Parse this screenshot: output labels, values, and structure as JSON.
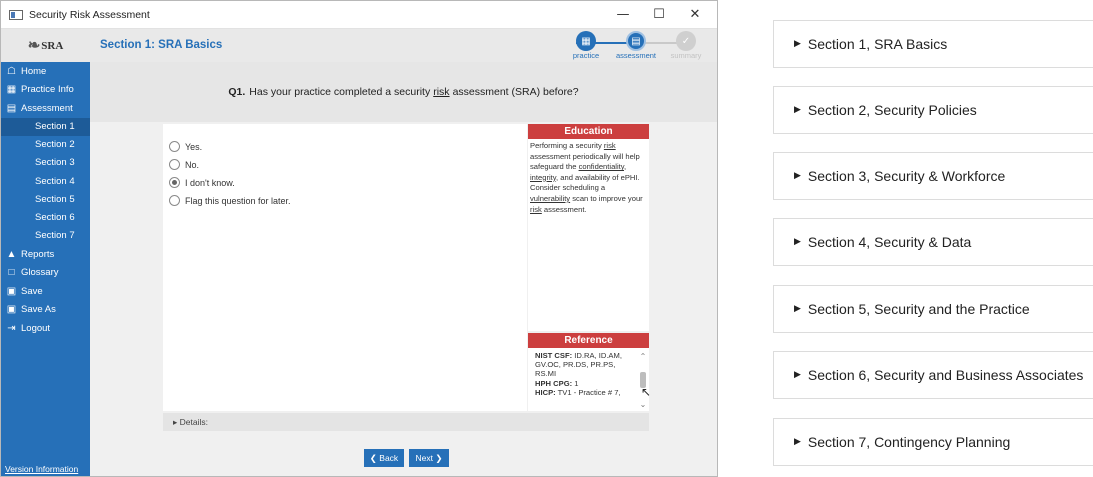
{
  "window": {
    "title": "Security Risk Assessment",
    "controls": {
      "minimize": "—",
      "maximize": "☐",
      "close": "✕"
    }
  },
  "logo": {
    "text": "SRA"
  },
  "sidebar": {
    "items": [
      {
        "label": "Home",
        "icon": "home-icon"
      },
      {
        "label": "Practice Info",
        "icon": "building-icon"
      },
      {
        "label": "Assessment",
        "icon": "clipboard-icon"
      }
    ],
    "sections": [
      "Section 1",
      "Section 2",
      "Section 3",
      "Section 4",
      "Section 5",
      "Section 6",
      "Section 7"
    ],
    "active_section": "Section 1",
    "bottom_items": [
      {
        "label": "Reports",
        "icon": "chart-icon"
      },
      {
        "label": "Glossary",
        "icon": "book-icon"
      },
      {
        "label": "Save",
        "icon": "save-icon"
      },
      {
        "label": "Save As",
        "icon": "save-as-icon"
      },
      {
        "label": "Logout",
        "icon": "logout-icon"
      }
    ],
    "version_link": "Version Information"
  },
  "header": {
    "section_title": "Section 1: SRA Basics",
    "steps": [
      {
        "label": "practice",
        "state": "done"
      },
      {
        "label": "assessment",
        "state": "current"
      },
      {
        "label": "summary",
        "state": "future"
      }
    ]
  },
  "question": {
    "number": "Q1.",
    "text_before": "Has your practice completed a security",
    "text_underlined": "risk",
    "text_after": "assessment (SRA) before?"
  },
  "answers": {
    "options": [
      "Yes.",
      "No.",
      "I don't know.",
      "Flag this question for later."
    ],
    "selected": "I don't know."
  },
  "education": {
    "heading": "Education",
    "text": "Performing a security risk assessment periodically will help safeguard the confidentiality, integrity, and availability of ePHI. Consider scheduling a vulnerability scan to improve your risk assessment."
  },
  "reference": {
    "heading": "Reference",
    "nist_label": "NIST CSF:",
    "nist_value": "ID.RA, ID.AM, GV.OC, PR.DS, PR.PS, RS.MI",
    "hph_label": "HPH CPG:",
    "hph_value": "1",
    "hicp_label": "HICP:",
    "hicp_value": "TV1 - Practice # 7,"
  },
  "details_label": "Details:",
  "buttons": {
    "back": "Back",
    "next": "Next"
  },
  "accordion": [
    "Section 1, SRA Basics",
    "Section 2, Security Policies",
    "Section 3, Security & Workforce",
    "Section 4, Security & Data",
    "Section 5, Security and the Practice",
    "Section 6, Security and Business Associates",
    "Section 7, Contingency Planning"
  ],
  "colors": {
    "primary": "#2670b8",
    "accent_red": "#cc3f3f",
    "panel_gray": "#e6e6e6"
  }
}
